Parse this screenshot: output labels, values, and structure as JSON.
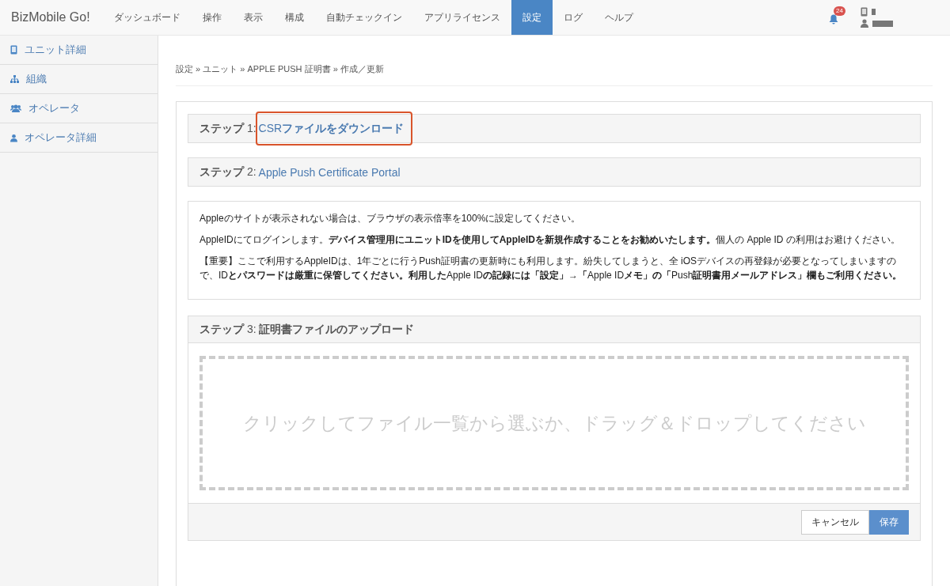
{
  "brand": "BizMobile Go!",
  "nav": [
    {
      "label": "ダッシュボード",
      "selected": false
    },
    {
      "label": "操作",
      "selected": false
    },
    {
      "label": "表示",
      "selected": false
    },
    {
      "label": "構成",
      "selected": false
    },
    {
      "label": "自動チェックイン",
      "selected": false
    },
    {
      "label": "アプリライセンス",
      "selected": false
    },
    {
      "label": "設定",
      "selected": true
    },
    {
      "label": "ログ",
      "selected": false
    },
    {
      "label": "ヘルプ",
      "selected": false
    }
  ],
  "notifications": {
    "count": "24"
  },
  "sidebar": {
    "items": [
      {
        "label": "ユニット詳細",
        "kind": "device"
      },
      {
        "label": "組織",
        "kind": "org"
      },
      {
        "label": "オペレータ",
        "kind": "group"
      },
      {
        "label": "オペレータ詳細",
        "kind": "user"
      }
    ]
  },
  "breadcrumb": "設定 » ユニット » APPLE PUSH 証明書 » 作成／更新",
  "steps": [
    {
      "heading": "**ステップ** 1:",
      "link": "CSR**ファイルをダウンロード**",
      "highlighted": true
    },
    {
      "heading": "**ステップ** 2:",
      "link": "Apple Push Certificate Portal",
      "highlighted": false
    }
  ],
  "notes": [
    "Appleのサイトが表示されない場合は、ブラウザの表示倍率を100%に設定してください。",
    "AppleIDにてログインします。**デバイス管理用にユニットIDを使用してAppleIDを新規作成することをお勧めいたします。**個人の Apple ID の利用はお避けください。",
    "【重要】ここで利用するAppleIDは、1年ごとに行うPush証明書の更新時にも利用します。紛失してしまうと、全 iOSデバイスの再登録が必要となってしまいますので、ID**とパスワードは厳重に保管してください。利用した**Apple ID**の記録には「設定」**→**「**Apple ID**メモ」の「**Push**証明書用メールアドレス」欄もご利用ください。**"
  ],
  "upload": {
    "heading": "**ステップ** 3: **証明書ファイルのアップロード**",
    "dropzone": "クリックしてファイル一覧から選ぶか、ドラッグ＆ドロップしてください"
  },
  "buttons": {
    "cancel": "キャンセル",
    "save": "保存"
  }
}
